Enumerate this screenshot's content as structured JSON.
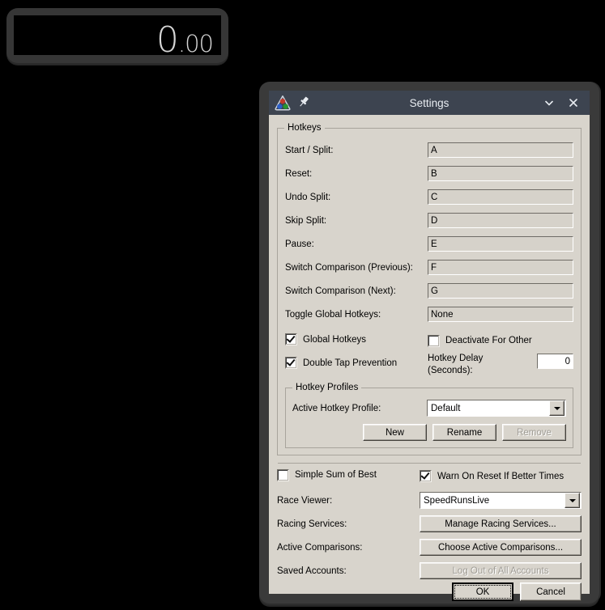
{
  "timer_window": {
    "name": "LiveSplit Timer",
    "time_seconds": "0",
    "time_fraction": ".00"
  },
  "settings_window": {
    "title": "Settings",
    "icons": {
      "app": "livesplit-icon",
      "pin": "pin-icon",
      "minimize": "chevron-down-icon",
      "close": "close-icon"
    },
    "hotkeys_group": {
      "title": "Hotkeys",
      "rows": [
        {
          "label": "Start / Split:",
          "value": "A"
        },
        {
          "label": "Reset:",
          "value": "B"
        },
        {
          "label": "Undo Split:",
          "value": "C"
        },
        {
          "label": "Skip Split:",
          "value": "D"
        },
        {
          "label": "Pause:",
          "value": "E"
        },
        {
          "label": "Switch Comparison (Previous):",
          "value": "F"
        },
        {
          "label": "Switch Comparison (Next):",
          "value": "G"
        },
        {
          "label": "Toggle Global Hotkeys:",
          "value": "None"
        }
      ],
      "global_hotkeys": {
        "label": "Global Hotkeys",
        "checked": true
      },
      "deactivate_for_other": {
        "label": "Deactivate For Other",
        "checked": false
      },
      "double_tap_prevention": {
        "label": "Double Tap Prevention",
        "checked": true
      },
      "hotkey_delay": {
        "label_line1": "Hotkey Delay",
        "label_line2": "(Seconds):",
        "value": "0"
      },
      "profiles_group": {
        "title": "Hotkey Profiles",
        "active_label": "Active Hotkey Profile:",
        "active_value": "Default",
        "new_button": "New",
        "rename_button": "Rename",
        "remove_button": "Remove"
      }
    },
    "general": {
      "simple_sum_of_best": {
        "label": "Simple Sum of Best",
        "checked": false
      },
      "warn_on_reset": {
        "label": "Warn On Reset If Better Times",
        "checked": true
      },
      "race_viewer": {
        "label": "Race Viewer:",
        "value": "SpeedRunsLive"
      },
      "racing_services": {
        "label": "Racing Services:",
        "button": "Manage Racing Services..."
      },
      "active_comparisons": {
        "label": "Active Comparisons:",
        "button": "Choose Active Comparisons..."
      },
      "saved_accounts": {
        "label": "Saved Accounts:",
        "button": "Log Out of All Accounts"
      }
    },
    "footer": {
      "ok": "OK",
      "cancel": "Cancel"
    },
    "colors": {
      "titlebar": "#3d4450",
      "dialog_face": "#d8d4cc",
      "frame": "#3a3a3a",
      "icon_red": "#c0392b",
      "icon_blue": "#2b5fc9",
      "icon_green": "#27952f"
    }
  }
}
